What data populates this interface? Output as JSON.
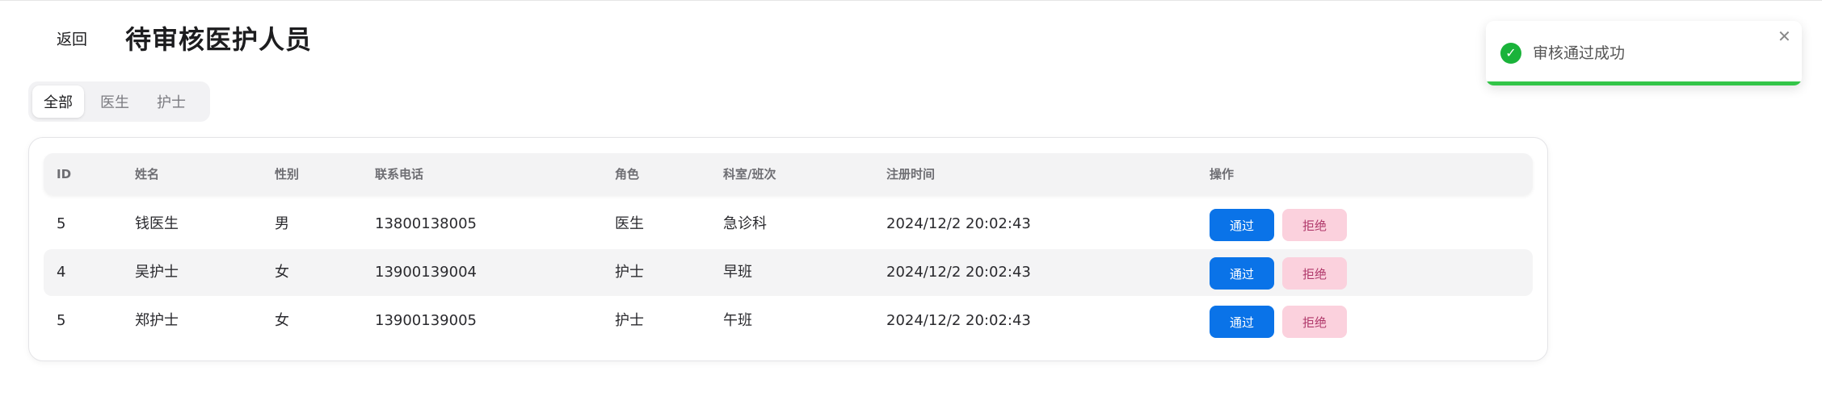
{
  "header": {
    "back_label": "返回",
    "title": "待审核医护人员"
  },
  "filter_tabs": [
    {
      "label": "全部",
      "active": true
    },
    {
      "label": "医生",
      "active": false
    },
    {
      "label": "护士",
      "active": false
    }
  ],
  "table": {
    "columns": [
      "ID",
      "姓名",
      "性别",
      "联系电话",
      "角色",
      "科室/班次",
      "注册时间",
      "操作"
    ],
    "rows": [
      {
        "id": "5",
        "name": "钱医生",
        "gender": "男",
        "phone": "13800138005",
        "role": "医生",
        "dept": "急诊科",
        "time": "2024/12/2 20:02:43",
        "approve": "通过",
        "reject": "拒绝"
      },
      {
        "id": "4",
        "name": "吴护士",
        "gender": "女",
        "phone": "13900139004",
        "role": "护士",
        "dept": "早班",
        "time": "2024/12/2 20:02:43",
        "approve": "通过",
        "reject": "拒绝"
      },
      {
        "id": "5",
        "name": "郑护士",
        "gender": "女",
        "phone": "13900139005",
        "role": "护士",
        "dept": "午班",
        "time": "2024/12/2 20:02:43",
        "approve": "通过",
        "reject": "拒绝"
      }
    ]
  },
  "toast": {
    "icon": "check-circle-icon",
    "message": "审核通过成功",
    "close_icon": "close-icon",
    "progress": 1.0,
    "color": "#1ab33a"
  },
  "colors": {
    "primary": "#0a73e8",
    "reject_bg": "#fbd1dd",
    "success": "#33c548"
  }
}
